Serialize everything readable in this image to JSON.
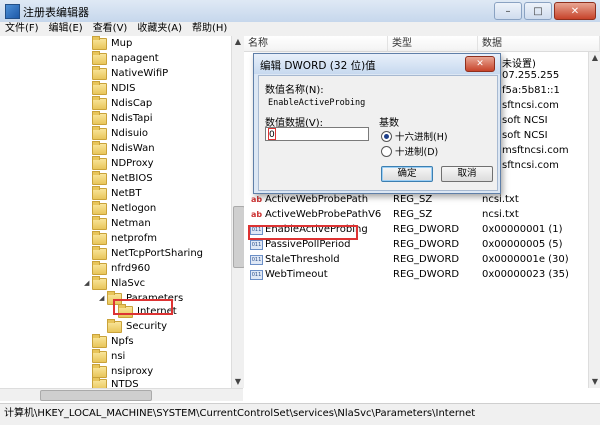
{
  "window": {
    "title": "注册表编辑器",
    "buttons": {
      "minimize": "–",
      "maximize": "□",
      "close": "✕"
    }
  },
  "menu": [
    "文件(F)",
    "编辑(E)",
    "查看(V)",
    "收藏夹(A)",
    "帮助(H)"
  ],
  "tree": {
    "items": [
      {
        "label": "Mup"
      },
      {
        "label": "napagent"
      },
      {
        "label": "NativeWifiP"
      },
      {
        "label": "NDIS"
      },
      {
        "label": "NdisCap"
      },
      {
        "label": "NdisTapi"
      },
      {
        "label": "Ndisuio"
      },
      {
        "label": "NdisWan"
      },
      {
        "label": "NDProxy"
      },
      {
        "label": "NetBIOS"
      },
      {
        "label": "NetBT"
      },
      {
        "label": "Netlogon"
      },
      {
        "label": "Netman"
      },
      {
        "label": "netprofm"
      },
      {
        "label": "NetTcpPortSharing"
      },
      {
        "label": "nfrd960"
      },
      {
        "label": "NlaSvc"
      },
      {
        "label": "Parameters"
      },
      {
        "label": "Internet"
      },
      {
        "label": "Security"
      },
      {
        "label": "Npfs"
      },
      {
        "label": "nsi"
      },
      {
        "label": "nsiproxy"
      },
      {
        "label": "NTDS"
      }
    ]
  },
  "list": {
    "columns": [
      "名称",
      "类型",
      "数据"
    ],
    "partial_data": [
      "未设置)",
      "07.255.255",
      "f5a:5b81::1",
      "sftncsi.com",
      "soft NCSI",
      "soft NCSI",
      "msftncsi.com",
      "sftncsi.com"
    ],
    "rows": [
      {
        "name": "ActiveWebProbePath",
        "type": "REG_SZ",
        "data": "ncsi.txt",
        "icon": "ab"
      },
      {
        "name": "ActiveWebProbePathV6",
        "type": "REG_SZ",
        "data": "ncsi.txt",
        "icon": "ab"
      },
      {
        "name": "EnableActiveProbing",
        "type": "REG_DWORD",
        "data": "0x00000001 (1)",
        "icon": "011"
      },
      {
        "name": "PassivePollPeriod",
        "type": "REG_DWORD",
        "data": "0x00000005 (5)",
        "icon": "011"
      },
      {
        "name": "StaleThreshold",
        "type": "REG_DWORD",
        "data": "0x0000001e (30)",
        "icon": "011"
      },
      {
        "name": "WebTimeout",
        "type": "REG_DWORD",
        "data": "0x00000023 (35)",
        "icon": "011"
      }
    ]
  },
  "dialog": {
    "title": "编辑 DWORD (32 位)值",
    "close": "✕",
    "value_name_label": "数值名称(N):",
    "value_name": "EnableActiveProbing",
    "value_data_label": "数值数据(V):",
    "value_data": "0",
    "base_label": "基数",
    "base_hex": "十六进制(H)",
    "base_dec": "十进制(D)",
    "ok": "确定",
    "cancel": "取消"
  },
  "statusbar": "计算机\\HKEY_LOCAL_MACHINE\\SYSTEM\\CurrentControlSet\\services\\NlaSvc\\Parameters\\Internet"
}
